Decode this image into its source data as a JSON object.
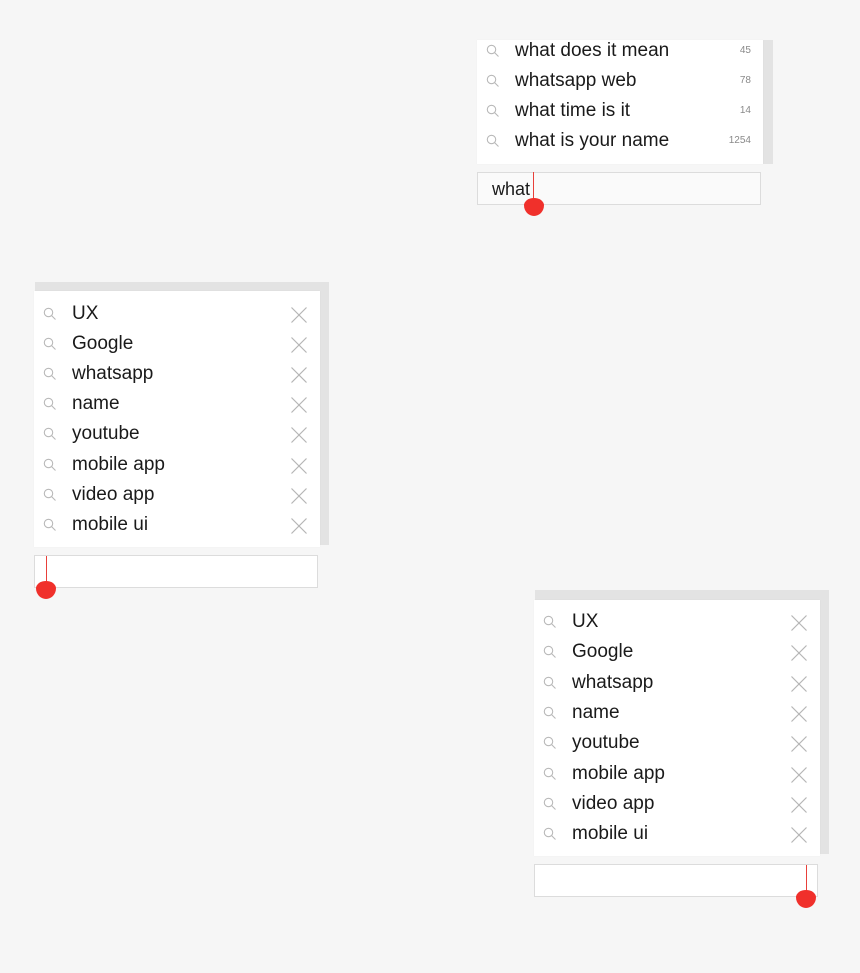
{
  "autocomplete": {
    "input_value": "what",
    "suggestions": [
      {
        "label": "what does it mean",
        "count": "45"
      },
      {
        "label": "whatsapp web",
        "count": "78"
      },
      {
        "label": "what time is it",
        "count": "14"
      },
      {
        "label": "what is your name",
        "count": "1254"
      }
    ]
  },
  "history_left": {
    "input_value": "",
    "items": [
      "UX",
      "Google",
      "whatsapp",
      "name",
      "youtube",
      "mobile app",
      "video app",
      "mobile ui"
    ]
  },
  "history_right": {
    "input_value": "",
    "items": [
      "UX",
      "Google",
      "whatsapp",
      "name",
      "youtube",
      "mobile app",
      "video app",
      "mobile ui"
    ]
  },
  "icons": {
    "search": "search-icon",
    "remove": "close-icon"
  },
  "colors": {
    "background": "#f6f6f6",
    "cursor": "#f0302b",
    "text": "#1a1a1a"
  }
}
